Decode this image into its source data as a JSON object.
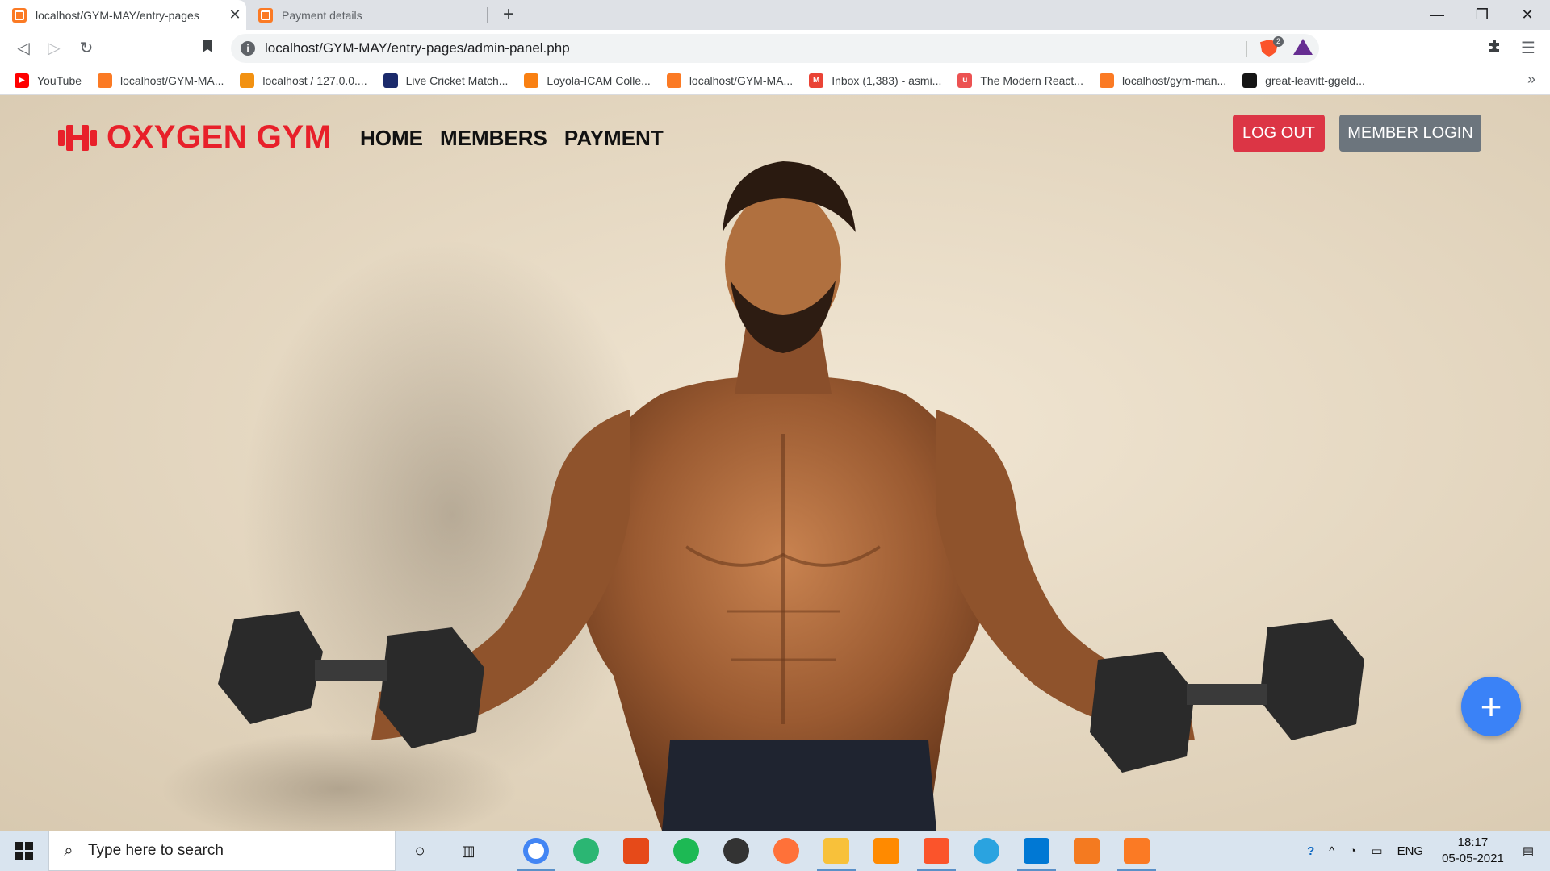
{
  "browser": {
    "tabs": [
      {
        "title": "localhost/GYM-MAY/entry-pages",
        "active": true
      },
      {
        "title": "Payment details",
        "active": false
      }
    ],
    "close_glyph": "✕",
    "new_tab_glyph": "+",
    "window_controls": {
      "minimize": "—",
      "restore": "❐",
      "close": "✕"
    },
    "url": "localhost/GYM-MAY/entry-pages/admin-panel.php",
    "brave_shield_count": "2",
    "bookmarks": [
      {
        "label": "YouTube",
        "icon": "youtube-icon",
        "color": "#ff0000"
      },
      {
        "label": "localhost/GYM-MA...",
        "icon": "xampp-icon",
        "color": "#fb7a24"
      },
      {
        "label": "localhost / 127.0.0....",
        "icon": "phpmyadmin-icon",
        "color": "#f29111"
      },
      {
        "label": "Live Cricket Match...",
        "icon": "cricket-icon",
        "color": "#1b2a6b"
      },
      {
        "label": "Loyola-ICAM Colle...",
        "icon": "moodle-icon",
        "color": "#f98012"
      },
      {
        "label": "localhost/GYM-MA...",
        "icon": "xampp-icon",
        "color": "#fb7a24"
      },
      {
        "label": "Inbox (1,383) - asmi...",
        "icon": "gmail-icon",
        "color": "#ea4335"
      },
      {
        "label": "The Modern React...",
        "icon": "udemy-icon",
        "color": "#ec5252"
      },
      {
        "label": "localhost/gym-man...",
        "icon": "xampp-icon",
        "color": "#fb7a24"
      },
      {
        "label": "great-leavitt-ggeld...",
        "icon": "codesandbox-icon",
        "color": "#151515"
      }
    ],
    "bookmarks_more": "»"
  },
  "site": {
    "logo_text": "OXYGEN GYM",
    "brand_color": "#e8202a",
    "nav": [
      "HOME",
      "MEMBERS",
      "PAYMENT"
    ],
    "logout_label": "LOG OUT",
    "member_login_label": "MEMBER LOGIN",
    "fab_label": "+"
  },
  "taskbar": {
    "search_placeholder": "Type here to search",
    "language": "ENG",
    "time": "18:17",
    "date": "05-05-2021"
  }
}
